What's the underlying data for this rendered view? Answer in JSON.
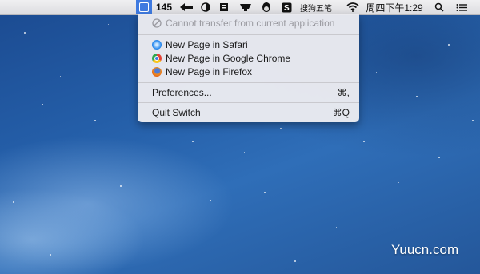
{
  "menubar": {
    "counter": "145",
    "ime_label": "搜狗五笔",
    "clock": "周四下午1:29",
    "icons": [
      "switch-app-icon",
      "arrow-icon",
      "half-circle-icon",
      "book-icon",
      "monitor-icon",
      "qq-penguin-icon",
      "sogou-icon",
      "wifi-icon",
      "search-icon",
      "list-icon"
    ]
  },
  "menu": {
    "disabled_item": "Cannot transfer from current application",
    "items": [
      {
        "label": "New Page in Safari",
        "icon": "safari-icon"
      },
      {
        "label": "New Page in Google Chrome",
        "icon": "chrome-icon"
      },
      {
        "label": "New Page in Firefox",
        "icon": "firefox-icon"
      }
    ],
    "preferences": {
      "label": "Preferences...",
      "shortcut": "⌘,"
    },
    "quit": {
      "label": "Quit Switch",
      "shortcut": "⌘Q"
    }
  },
  "watermark": "Yuucn.com",
  "colors": {
    "menubar_selection": "#3f7ae0",
    "desktop": "#245ea8"
  }
}
